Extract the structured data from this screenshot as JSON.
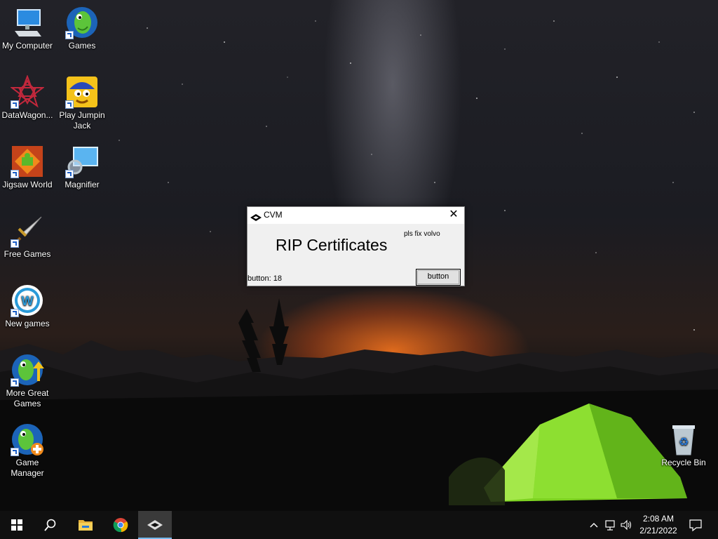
{
  "desktop": {
    "icons": [
      {
        "label": "My Computer",
        "icon": "computer-icon",
        "shortcut": false
      },
      {
        "label": "Games",
        "icon": "games-fish-icon",
        "shortcut": true
      },
      {
        "label": "DataWagon...",
        "icon": "datawagon-icon",
        "shortcut": true
      },
      {
        "label": "Play Jumpin Jack",
        "icon": "jumpin-jack-icon",
        "shortcut": true
      },
      {
        "label": "Jigsaw World",
        "icon": "jigsaw-icon",
        "shortcut": true
      },
      {
        "label": "Magnifier",
        "icon": "magnifier-icon",
        "shortcut": true
      },
      {
        "label": "Free Games",
        "icon": "sword-icon",
        "shortcut": true
      },
      {
        "label": "New games",
        "icon": "new-games-icon",
        "shortcut": true
      },
      {
        "label": "More Great Games",
        "icon": "more-games-icon",
        "shortcut": true
      },
      {
        "label": "Game Manager",
        "icon": "game-manager-icon",
        "shortcut": true
      },
      {
        "label": "Recycle Bin",
        "icon": "recycle-bin-icon",
        "shortcut": false
      }
    ]
  },
  "dialog": {
    "title": "CVM",
    "close_glyph": "✕",
    "headline": "RIP Certificates",
    "note": "pls fix volvo",
    "status": "button: 18",
    "button_label": "button"
  },
  "taskbar": {
    "pinned": [
      "windows-start-icon",
      "search-icon",
      "file-explorer-icon",
      "chrome-icon",
      "cvm-app-icon"
    ],
    "active": "cvm-app-icon",
    "time": "2:08 AM",
    "date": "2/21/2022"
  },
  "colors": {
    "taskbar_bg": "#101010",
    "active_indicator": "#76b9ed",
    "dialog_bg": "#f0f0f0",
    "tent_green": "#7ed321"
  }
}
